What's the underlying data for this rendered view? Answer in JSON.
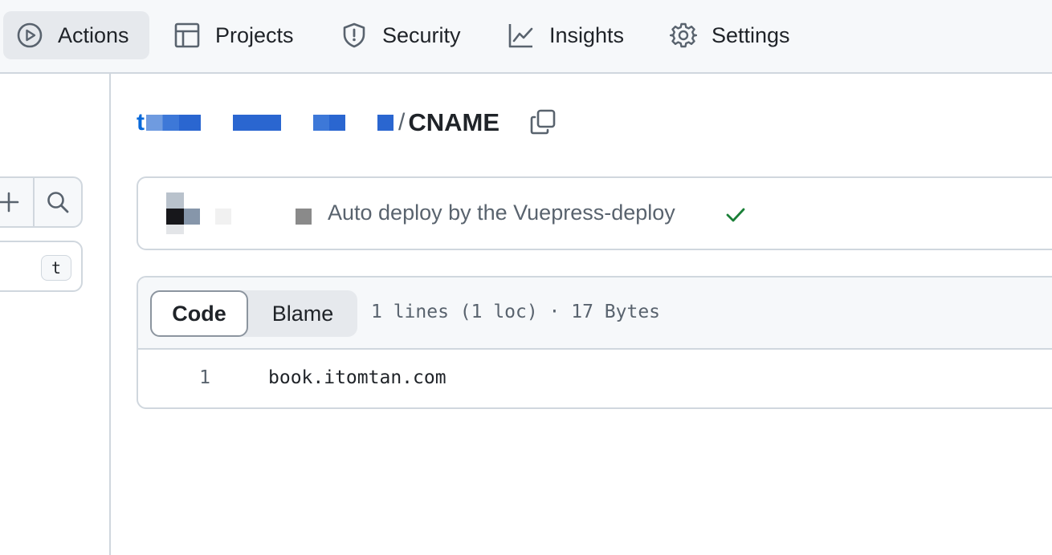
{
  "topnav": {
    "tabs": [
      {
        "label": "Actions",
        "icon": "play-circle-icon",
        "active": true
      },
      {
        "label": "Projects",
        "icon": "table-icon",
        "active": false
      },
      {
        "label": "Security",
        "icon": "shield-icon",
        "active": false
      },
      {
        "label": "Insights",
        "icon": "graph-icon",
        "active": false
      },
      {
        "label": "Settings",
        "icon": "gear-icon",
        "active": false
      }
    ]
  },
  "sidebar": {
    "add_icon": "plus-icon",
    "search_icon": "search-icon",
    "filter_shortcut": "t"
  },
  "breadcrumb": {
    "first_segment": "t",
    "separator": "/",
    "file_name": "CNAME",
    "copy_icon": "copy-icon"
  },
  "commit": {
    "message": "Auto deploy by the Vuepress-deploy",
    "status_icon": "check-icon",
    "status_color": "#1a7f37"
  },
  "file": {
    "view_tabs": {
      "code": "Code",
      "blame": "Blame"
    },
    "info": "1 lines (1 loc) · 17 Bytes",
    "lines": [
      {
        "number": "1",
        "content": "book.itomtan.com"
      }
    ]
  },
  "colors": {
    "link": "#0969da",
    "border": "#d0d7de",
    "header_bg": "#f6f8fa",
    "muted_text": "#59636e"
  }
}
